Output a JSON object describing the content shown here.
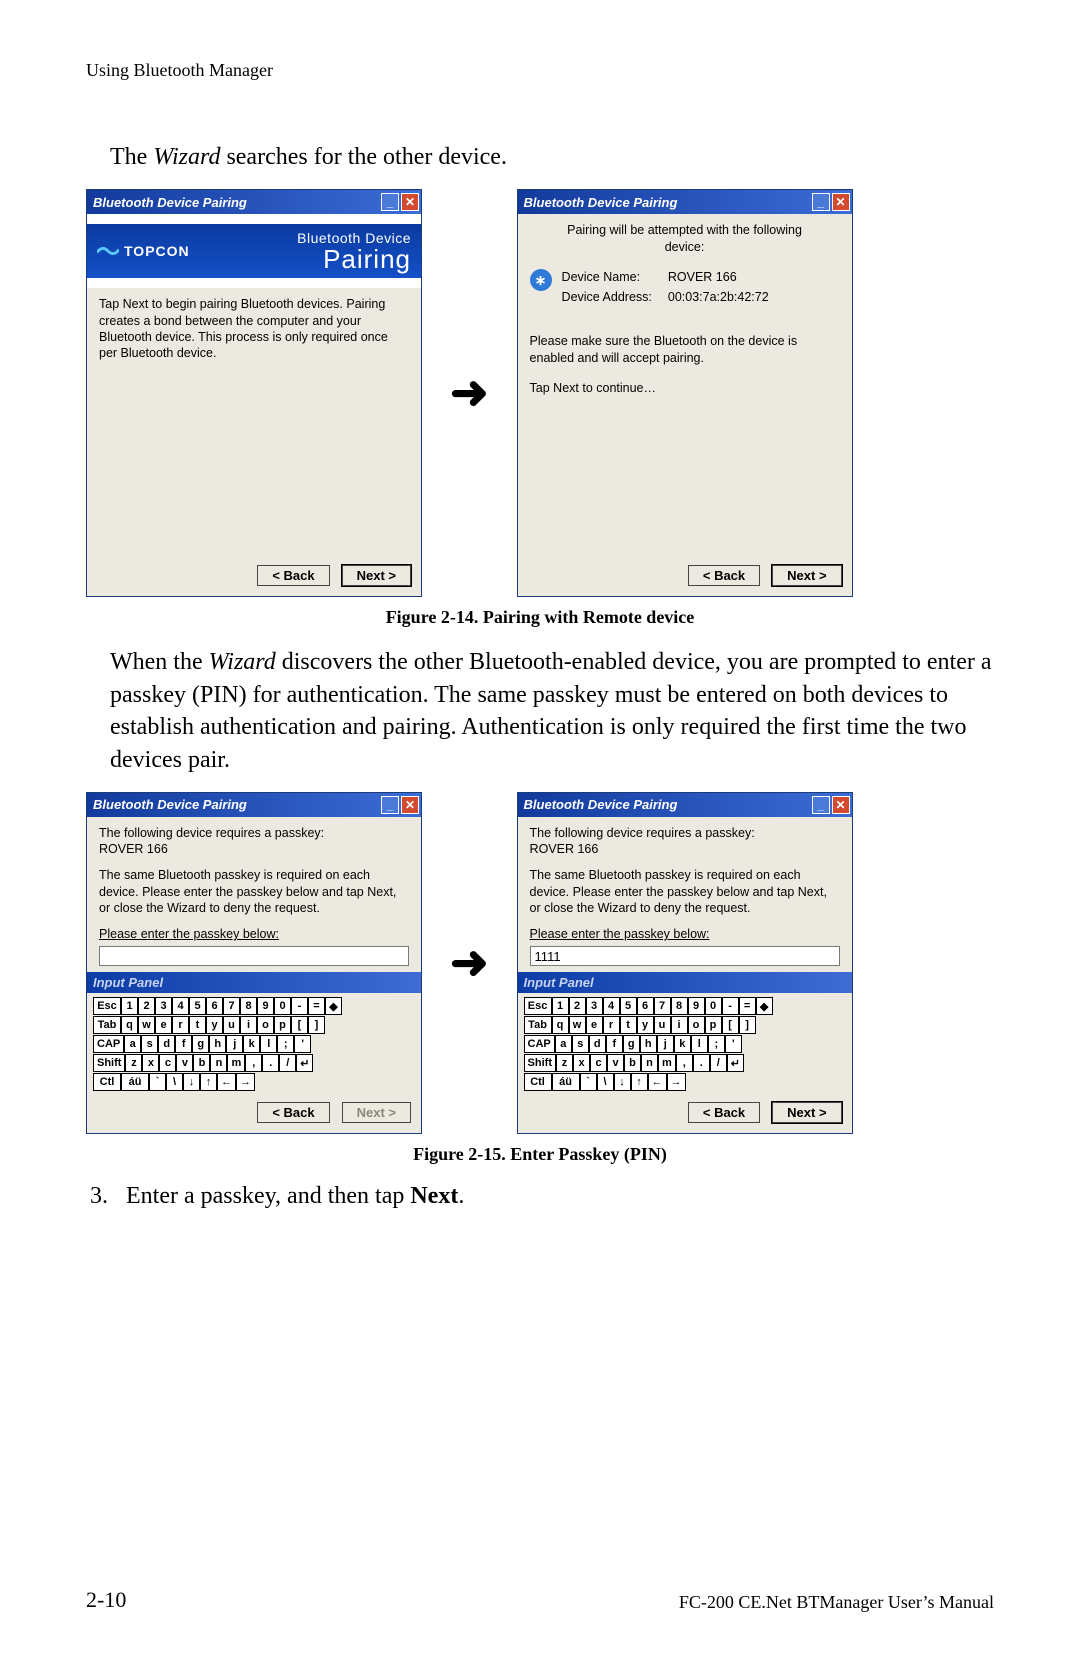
{
  "header": "Using Bluetooth Manager",
  "intro": {
    "pre": "The ",
    "wizard": "Wizard",
    "post": " searches for the other device."
  },
  "fig1_caption": "Figure 2-14. Pairing with Remote device",
  "fig2_caption": "Figure 2-15. Enter Passkey (PIN)",
  "para2": {
    "pre": "When the ",
    "wizard": "Wizard",
    "post": " discovers the other Bluetooth-enabled device, you are prompted to enter a passkey (PIN) for authentication. The same passkey must be entered on both devices to establish authentication and pairing. Authentication is only required the first time the two devices pair."
  },
  "step3": {
    "num": "3.",
    "text": "Enter a passkey, and then tap ",
    "bold": "Next",
    "tail": "."
  },
  "footer": {
    "page": "2-10",
    "doc": "FC-200 CE.Net BTManager User’s Manual"
  },
  "dlg": {
    "title": "Bluetooth Device Pairing",
    "back": "< Back",
    "next": "Next >",
    "banner_logo": "TOPCON",
    "banner_line1": "Bluetooth Device",
    "banner_line2": "Pairing"
  },
  "d1": {
    "text": "Tap Next to begin pairing Bluetooth devices. Pairing creates a bond between the computer and your Bluetooth device. This process is only required once per Bluetooth device."
  },
  "d2": {
    "intro": "Pairing will be attempted with the following\ndevice:",
    "name_label": "Device Name:",
    "name_value": "ROVER 166",
    "addr_label": "Device Address:",
    "addr_value": "00:03:7a:2b:42:72",
    "note": "Please make sure the Bluetooth on the device is enabled and will accept pairing.",
    "cont": "Tap Next to continue…"
  },
  "d3": {
    "line1": "The following device requires a passkey:",
    "device": "ROVER 166",
    "line2": "The same Bluetooth passkey is required on each device. Please enter the passkey below and tap Next, or close the Wizard to deny the request.",
    "prompt": "Please enter the passkey below:",
    "value": "",
    "section": "Input Panel"
  },
  "d4": {
    "value": "1111"
  },
  "kb": {
    "r1": [
      "Esc",
      "1",
      "2",
      "3",
      "4",
      "5",
      "6",
      "7",
      "8",
      "9",
      "0",
      "-",
      "=",
      "◆"
    ],
    "r2": [
      "Tab",
      "q",
      "w",
      "e",
      "r",
      "t",
      "y",
      "u",
      "i",
      "o",
      "p",
      "[",
      "]"
    ],
    "r3": [
      "CAP",
      "a",
      "s",
      "d",
      "f",
      "g",
      "h",
      "j",
      "k",
      "l",
      ";",
      "'"
    ],
    "r4": [
      "Shift",
      "z",
      "x",
      "c",
      "v",
      "b",
      "n",
      "m",
      ",",
      ".",
      "/",
      "↵"
    ],
    "r5": [
      "Ctl",
      "áü",
      "`",
      "\\",
      "↓",
      "↑",
      "←",
      "→"
    ]
  }
}
